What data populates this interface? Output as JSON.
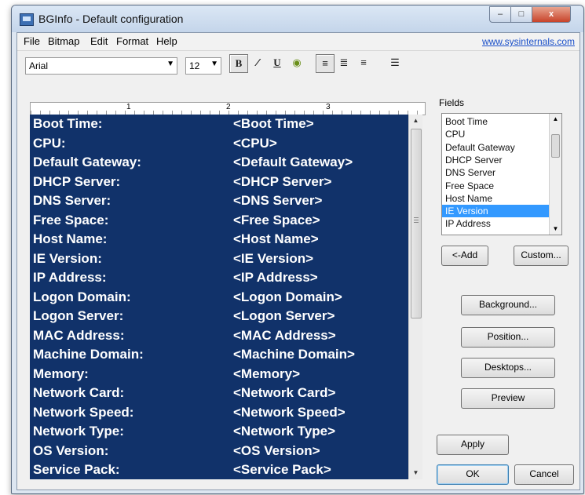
{
  "window": {
    "title": "BGInfo - Default configuration",
    "controls": [
      "–",
      "□",
      "x"
    ]
  },
  "menu": {
    "items": [
      "File",
      "Bitmap",
      "Edit",
      "Format",
      "Help"
    ],
    "link": "www.sysinternals.com"
  },
  "toolbar": {
    "font": "Arial",
    "size": "12",
    "bold": "B",
    "italic": "⁄",
    "underline": "U",
    "color": "◉",
    "align_left": "≡",
    "align_center": "≣",
    "align_right": "≡",
    "bullets": "☰"
  },
  "ruler": [
    "1",
    "2",
    "3"
  ],
  "editor": {
    "rows": [
      {
        "label": "Boot Time:",
        "value": "<Boot Time>"
      },
      {
        "label": "CPU:",
        "value": "<CPU>"
      },
      {
        "label": "Default Gateway:",
        "value": "<Default Gateway>"
      },
      {
        "label": "DHCP Server:",
        "value": "<DHCP Server>"
      },
      {
        "label": "DNS Server:",
        "value": "<DNS Server>"
      },
      {
        "label": "Free Space:",
        "value": "<Free Space>"
      },
      {
        "label": "Host Name:",
        "value": "<Host Name>"
      },
      {
        "label": "IE Version:",
        "value": "<IE Version>"
      },
      {
        "label": "IP Address:",
        "value": "<IP Address>"
      },
      {
        "label": "Logon Domain:",
        "value": "<Logon Domain>"
      },
      {
        "label": "Logon Server:",
        "value": "<Logon Server>"
      },
      {
        "label": "MAC Address:",
        "value": "<MAC Address>"
      },
      {
        "label": "Machine Domain:",
        "value": "<Machine Domain>"
      },
      {
        "label": "Memory:",
        "value": "<Memory>"
      },
      {
        "label": "Network Card:",
        "value": "<Network Card>"
      },
      {
        "label": "Network Speed:",
        "value": "<Network Speed>"
      },
      {
        "label": "Network Type:",
        "value": "<Network Type>"
      },
      {
        "label": "OS Version:",
        "value": "<OS Version>"
      },
      {
        "label": "Service Pack:",
        "value": "<Service Pack>"
      }
    ]
  },
  "fields": {
    "label": "Fields",
    "items": [
      "Boot Time",
      "CPU",
      "Default Gateway",
      "DHCP Server",
      "DNS Server",
      "Free Space",
      "Host Name",
      "IE Version",
      "IP Address"
    ],
    "selected": "IE Version"
  },
  "buttons": {
    "add": "<-Add",
    "custom": "Custom...",
    "background": "Background...",
    "position": "Position...",
    "desktops": "Desktops...",
    "preview": "Preview",
    "apply": "Apply",
    "ok": "OK",
    "cancel": "Cancel"
  }
}
